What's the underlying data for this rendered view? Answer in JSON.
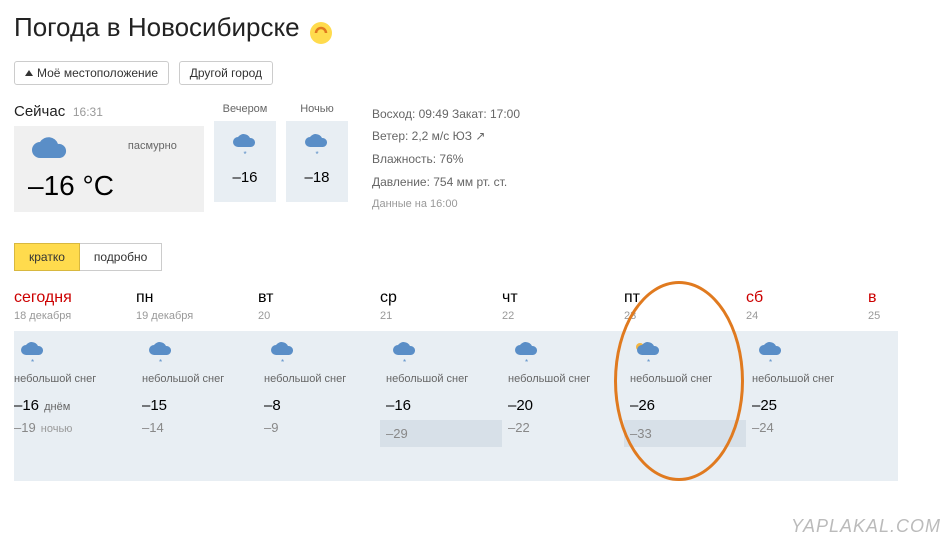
{
  "header": {
    "title": "Погода в Новосибирске",
    "my_location": "Моё местоположение",
    "other_city": "Другой город"
  },
  "now": {
    "label": "Сейчас",
    "time": "16:31",
    "temp": "–16 °C",
    "condition": "пасмурно",
    "parts": [
      {
        "label": "Вечером",
        "temp": "–16"
      },
      {
        "label": "Ночью",
        "temp": "–18"
      }
    ]
  },
  "details": {
    "sun": "Восход: 09:49  Закат: 17:00",
    "wind": "Ветер: 2,2 м/с  ЮЗ",
    "humidity": "Влажность: 76%",
    "pressure": "Давление: 754 мм рт. ст.",
    "data_time": "Данные на 16:00"
  },
  "tabs": {
    "brief": "кратко",
    "detail": "подробно"
  },
  "forecast": [
    {
      "name": "сегодня",
      "date": "18 декабря",
      "weekend": true,
      "cond": "небольшой снег",
      "hi": "–16",
      "hi_sub": "днём",
      "lo": "–19",
      "lo_sub": "ночью",
      "lo_bg": false
    },
    {
      "name": "пн",
      "date": "19 декабря",
      "weekend": false,
      "cond": "небольшой снег",
      "hi": "–15",
      "hi_sub": "",
      "lo": "–14",
      "lo_sub": "",
      "lo_bg": false
    },
    {
      "name": "вт",
      "date": "20",
      "weekend": false,
      "cond": "небольшой снег",
      "hi": "–8",
      "hi_sub": "",
      "lo": "–9",
      "lo_sub": "",
      "lo_bg": false
    },
    {
      "name": "ср",
      "date": "21",
      "weekend": false,
      "cond": "небольшой снег",
      "hi": "–16",
      "hi_sub": "",
      "lo": "–29",
      "lo_sub": "",
      "lo_bg": true
    },
    {
      "name": "чт",
      "date": "22",
      "weekend": false,
      "cond": "небольшой снег",
      "hi": "–20",
      "hi_sub": "",
      "lo": "–22",
      "lo_sub": "",
      "lo_bg": false
    },
    {
      "name": "пт",
      "date": "23",
      "weekend": false,
      "cond": "небольшой снег",
      "hi": "–26",
      "hi_sub": "",
      "lo": "–33",
      "lo_sub": "",
      "lo_bg": true
    },
    {
      "name": "сб",
      "date": "24",
      "weekend": true,
      "cond": "небольшой снег",
      "hi": "–25",
      "hi_sub": "",
      "lo": "–24",
      "lo_sub": "",
      "lo_bg": false
    },
    {
      "name": "в",
      "date": "25",
      "weekend": true,
      "cond": "",
      "hi": "",
      "hi_sub": "",
      "lo": "",
      "lo_sub": "",
      "lo_bg": false
    }
  ],
  "watermark": "YAPLAKAL.COM"
}
